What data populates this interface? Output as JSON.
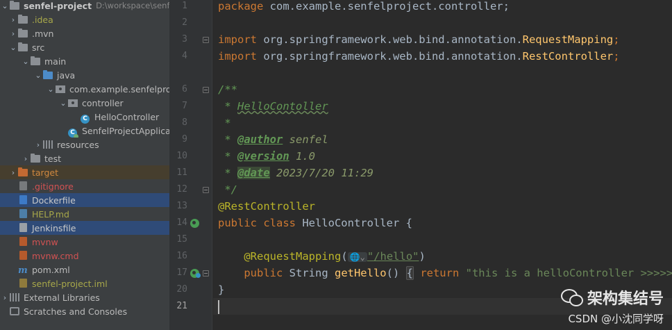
{
  "tree": {
    "project": {
      "name": "senfel-project",
      "path": "D:\\workspace\\senfel-"
    },
    "idea": ".idea",
    "mvn": ".mvn",
    "src": "src",
    "main": "main",
    "java": "java",
    "package": "com.example.senfelproje",
    "controller": "controller",
    "hello_controller": "HelloController",
    "app_class": "SenfelProjectApplicat",
    "resources": "resources",
    "test": "test",
    "target": "target",
    "gitignore": ".gitignore",
    "dockerfile": "Dockerfile",
    "help": "HELP.md",
    "jenkinsfile": "Jenkinsfile",
    "mvnw": "mvnw",
    "mvnw_cmd": "mvnw.cmd",
    "pom": "pom.xml",
    "iml": "senfel-project.iml",
    "external_libraries": "External Libraries",
    "scratches": "Scratches and Consoles",
    "class_glyph": "C"
  },
  "gutter": {
    "line_numbers": [
      "1",
      "2",
      "3",
      "4",
      "6",
      "7",
      "8",
      "9",
      "10",
      "11",
      "12",
      "13",
      "14",
      "15",
      "16",
      "17",
      "20",
      "21"
    ]
  },
  "code": {
    "l1_kw": "package",
    "l1_rest": " com.example.senfelproject.controller;",
    "l3_kw": "import",
    "l3_pkg": " org.springframework.web.bind.annotation.",
    "l3_cls": "RequestMapping",
    "l3_end": ";",
    "l4_kw": "import",
    "l4_pkg": " org.springframework.web.bind.annotation.",
    "l4_cls": "RestController",
    "l4_end": ";",
    "l6": "/**",
    "l7_star": " * ",
    "l7_name": "HelloContoller",
    "l8": " *",
    "l9_star": " * ",
    "l9_tag": "@author",
    "l9_val": " senfel",
    "l10_star": " * ",
    "l10_tag": "@version",
    "l10_val": " 1.0",
    "l11_star": " * ",
    "l11_tag": "@date",
    "l11_val": " 2023/7/20 11:29",
    "l12": " */",
    "l13": "@RestController",
    "l14_kw": "public class",
    "l14_rest": " HelloController {",
    "l16_indent": "    ",
    "l16_ann": "@RequestMapping",
    "l16_paren": "(",
    "l16_inlay": "🌐⌄",
    "l16_str": "\"/hello\"",
    "l16_close": ")",
    "l17_indent": "    ",
    "l17_kw": "public",
    "l17_type": " String ",
    "l17_fn": "getHello",
    "l17_paren": "() ",
    "l17_brace": "{",
    "l17_ret": " return ",
    "l17_str": "\"this is a helloController >>>>>>>>",
    "l20": "}"
  },
  "watermark": {
    "title": "架构集结号",
    "subtitle": "CSDN @小沈同学呀"
  }
}
